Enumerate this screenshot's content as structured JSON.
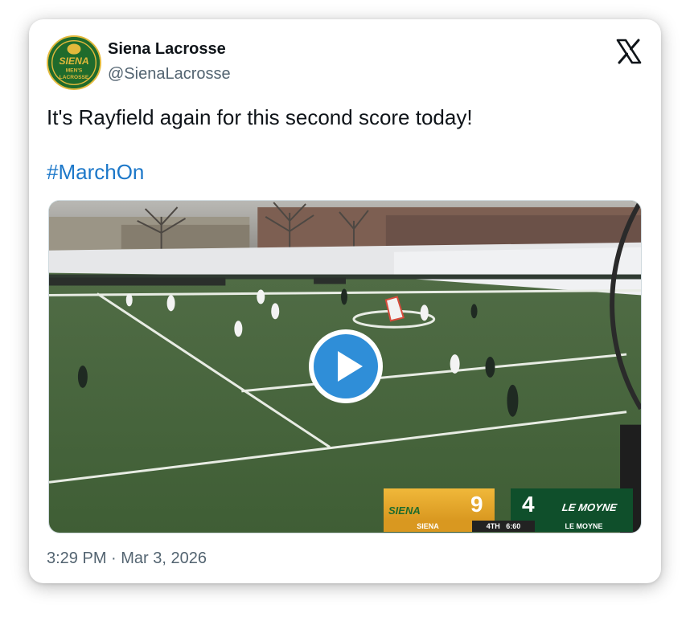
{
  "author": {
    "display_name": "Siena Lacrosse",
    "handle": "@SienaLacrosse",
    "avatar_text_top": "SIENA",
    "avatar_text_mid": "MEN'S",
    "avatar_text_bottom": "LACROSSE"
  },
  "tweet": {
    "text": "It's Rayfield again for this second score today!",
    "hashtag": "#MarchOn",
    "timestamp": "3:29 PM · Mar 3, 2026"
  },
  "scorebug": {
    "home_logo": "SIENA",
    "home_score": "9",
    "home_name": "SIENA",
    "away_score": "4",
    "away_logo": "LE MOYNE",
    "away_name": "LE MOYNE",
    "period": "4TH",
    "clock": "6:60"
  },
  "icons": {
    "brand": "x-logo-icon",
    "play": "play-icon"
  },
  "colors": {
    "link": "#1d78c9",
    "play_button": "#2f8ed8",
    "field_green": "#4c6b3c",
    "siena_gold": "#e2a82b",
    "lemoyne_green": "#0f4f2b"
  }
}
